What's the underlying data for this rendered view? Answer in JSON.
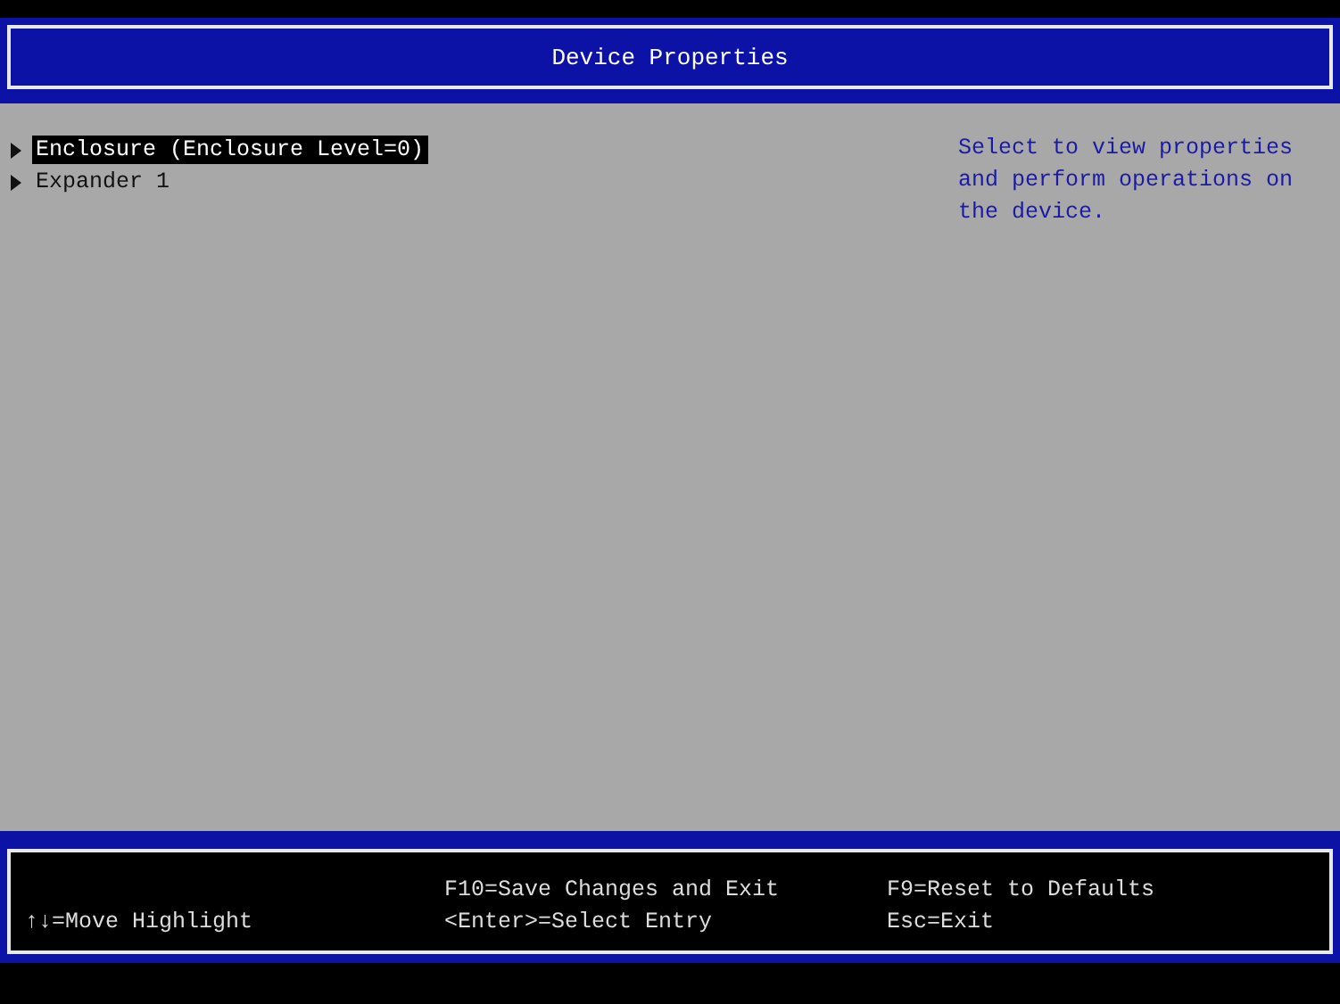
{
  "window": {
    "title": "Device Properties"
  },
  "menu": {
    "items": [
      {
        "label": "Enclosure (Enclosure Level=0)",
        "selected": true
      },
      {
        "label": "Expander 1",
        "selected": false
      }
    ]
  },
  "help_text": "Select to view properties and perform operations on the device.",
  "footer": {
    "columns": [
      [
        "↑↓=Move Highlight"
      ],
      [
        "F10=Save Changes and Exit",
        "<Enter>=Select Entry"
      ],
      [
        "F9=Reset to Defaults",
        "Esc=Exit"
      ]
    ]
  }
}
